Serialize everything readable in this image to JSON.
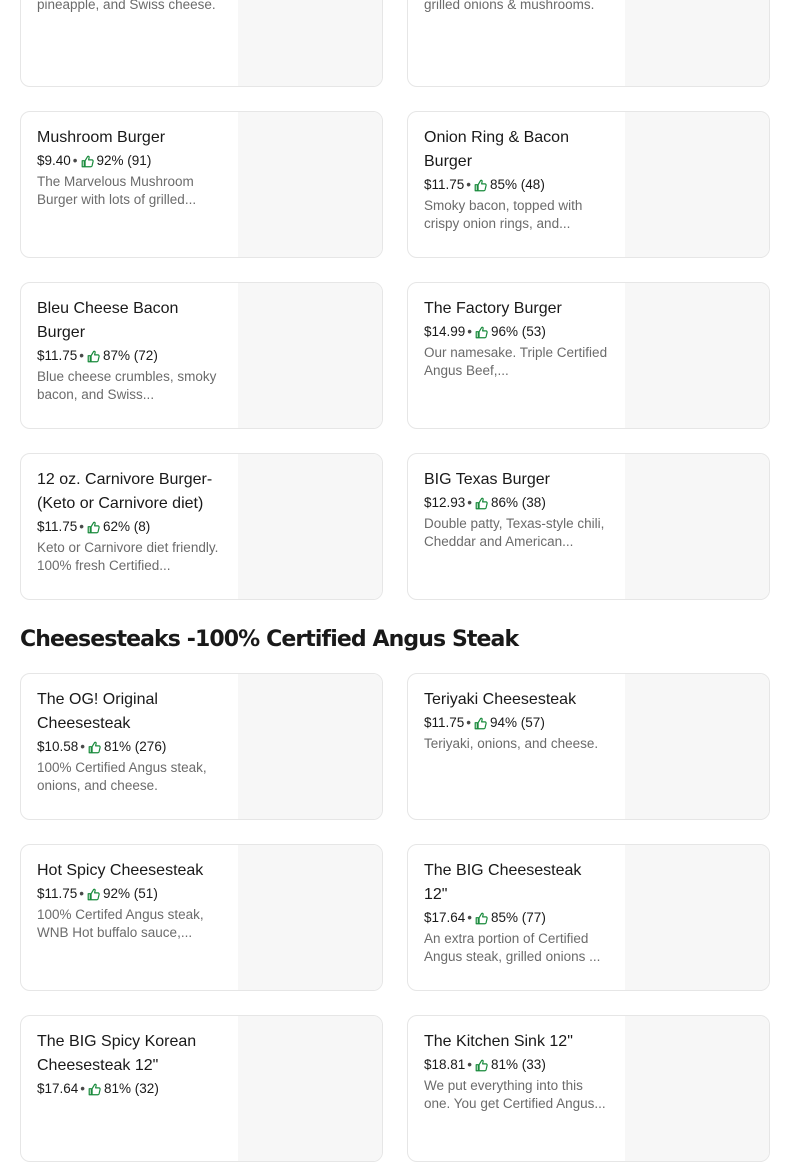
{
  "colors": {
    "text": "#191919",
    "muted": "#6b6b6b",
    "rating_icon": "#1a8b3d",
    "card_border": "#e6e6e6",
    "image_placeholder": "#f7f7f7"
  },
  "burgers": {
    "items": [
      {
        "name": "",
        "price": "",
        "rating": "",
        "description": "Teriyaki glazed, grilled pineapple, and Swiss cheese."
      },
      {
        "name": "",
        "price": "",
        "rating": "",
        "description": "Korean-style bbq sauce, grilled onions & mushrooms."
      },
      {
        "name": "Mushroom Burger",
        "price": "$9.40",
        "rating": "92% (91)",
        "description": "The Marvelous Mushroom Burger with lots of grilled..."
      },
      {
        "name": "Onion Ring & Bacon Burger",
        "price": "$11.75",
        "rating": "85% (48)",
        "description": "Smoky bacon, topped with crispy onion rings, and..."
      },
      {
        "name": "Bleu Cheese Bacon Burger",
        "price": "$11.75",
        "rating": "87% (72)",
        "description": "Blue cheese crumbles, smoky bacon, and Swiss..."
      },
      {
        "name": "The Factory Burger",
        "price": "$14.99",
        "rating": "96% (53)",
        "description": "Our namesake. Triple Certified Angus Beef,..."
      },
      {
        "name": "12 oz. Carnivore Burger-(Keto or Carnivore diet)",
        "price": "$11.75",
        "rating": "62% (8)",
        "description": "Keto or Carnivore diet friendly. 100% fresh Certified..."
      },
      {
        "name": "BIG Texas Burger",
        "price": "$12.93",
        "rating": "86% (38)",
        "description": "Double patty, Texas-style chili, Cheddar and American..."
      }
    ]
  },
  "cheesesteaks": {
    "title": "Cheesesteaks -100% Certified Angus Steak",
    "items": [
      {
        "name": "The OG! Original Cheesesteak",
        "price": "$10.58",
        "rating": "81% (276)",
        "description": "100% Certified Angus steak, onions, and cheese."
      },
      {
        "name": "Teriyaki Cheesesteak",
        "price": "$11.75",
        "rating": "94% (57)",
        "description": "Teriyaki, onions, and cheese."
      },
      {
        "name": "Hot Spicy Cheesesteak",
        "price": "$11.75",
        "rating": "92% (51)",
        "description": "100% Certifed Angus steak, WNB Hot buffalo sauce,..."
      },
      {
        "name": "The BIG Cheesesteak 12\"",
        "price": "$17.64",
        "rating": "85% (77)",
        "description": "An extra portion of Certified Angus steak, grilled onions ..."
      },
      {
        "name": "The BIG Spicy Korean Cheesesteak 12\"",
        "price": "$17.64",
        "rating": "81% (32)",
        "description": ""
      },
      {
        "name": "The Kitchen Sink 12\"",
        "price": "$18.81",
        "rating": "81% (33)",
        "description": "We put everything into this one. You get Certified Angus..."
      }
    ]
  }
}
